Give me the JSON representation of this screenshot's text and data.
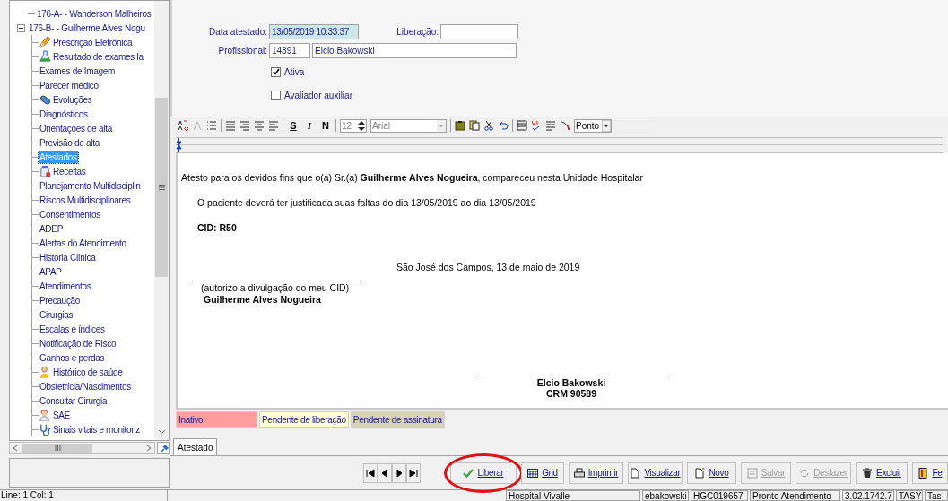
{
  "tree": [
    {
      "label": "176-A-  - Wanderson Malheiros",
      "selected": false
    },
    {
      "label": "176-B-  - Guilherme Alves Nogu",
      "selected": false,
      "expanded": true,
      "children": [
        {
          "label": "Prescrição Eletrônica",
          "kind": "pencil",
          "selected": false
        },
        {
          "label": "Resultado de exames la",
          "kind": "flask",
          "selected": false
        },
        {
          "label": "Exames de Imagem",
          "selected": false
        },
        {
          "label": "Parecer médico",
          "selected": false
        },
        {
          "label": "Evoluções",
          "kind": "capsule",
          "selected": false
        },
        {
          "label": "Diagnósticos",
          "selected": false
        },
        {
          "label": "Orientações de alta",
          "selected": false
        },
        {
          "label": "Previsão de alta",
          "selected": false
        },
        {
          "label": "Atestados",
          "selected": true
        },
        {
          "label": "Receitas",
          "kind": "bottle",
          "selected": false
        },
        {
          "label": "Planejamento Multidisciplin",
          "selected": false
        },
        {
          "label": "Riscos Multidisciplinares",
          "selected": false
        },
        {
          "label": "Consentimentos",
          "selected": false
        },
        {
          "label": "ADEP",
          "selected": false
        },
        {
          "label": "Alertas do Atendimento",
          "selected": false
        },
        {
          "label": "História Clínica",
          "selected": false
        },
        {
          "label": "APAP",
          "selected": false
        },
        {
          "label": "Atendimentos",
          "selected": false
        },
        {
          "label": "Precaução",
          "selected": false
        },
        {
          "label": "Cirurgias",
          "selected": false
        },
        {
          "label": "Escalas e índices",
          "selected": false
        },
        {
          "label": "Notificação de Risco",
          "selected": false
        },
        {
          "label": "Ganhos e perdas",
          "selected": false
        },
        {
          "label": "Histórico de saúde",
          "kind": "person",
          "selected": false
        },
        {
          "label": "Obstetrícia/Nascimentos",
          "selected": false
        },
        {
          "label": "Consultar Cirurgia",
          "selected": false
        },
        {
          "label": "SAE",
          "kind": "nurse",
          "selected": false
        },
        {
          "label": "Sinais vitais e monitoriz",
          "kind": "stethoscope",
          "selected": false
        }
      ]
    }
  ],
  "form": {
    "data_atestado": {
      "label": "Data atestado:",
      "value": "13/05/2019 10:33:37"
    },
    "liberacao": {
      "label": "Liberação:"
    },
    "profissional": {
      "label": "Profissional:",
      "code": "14391",
      "name": "Elcio Bakowski"
    },
    "checkboxes": [
      {
        "label": "Ativa",
        "checked": true
      },
      {
        "label": "Avaliador auxiliar",
        "checked": false
      }
    ]
  },
  "editor_toolbar": {
    "style_buttons": [
      "S",
      "I",
      "N"
    ],
    "font_size": "12",
    "font": "Arial",
    "unit": "Ponto"
  },
  "document": [
    {
      "kind": "lead",
      "text": "Atesto para os devidos fins que o(a) Sr.(a) **Guilherme Alves Nogueira**, compareceu nesta Unidade Hospitalar"
    },
    {
      "kind": "indent",
      "text": "O paciente deverá ter justificada suas faltas do dia 13/05/2019  ao dia 13/05/2019"
    },
    {
      "kind": "cid",
      "text": "CID: R50"
    },
    {
      "kind": "place_date",
      "text": "São José dos Campos, 13 de maio de 2019"
    },
    {
      "kind": "patient_signature",
      "note": "(autorizo a divulgação do meu CID)",
      "name": "Guilherme Alves Nogueira"
    },
    {
      "kind": "doctor_signature",
      "name": "Elcio Bakowski",
      "crm": "CRM 90589"
    }
  ],
  "legend": [
    {
      "label": "Inativo",
      "color": "#ff9c9c"
    },
    {
      "label": "Pendente de liberação",
      "color": "#ffffcc"
    },
    {
      "label": "Pendente de assinatura",
      "color": "#d6d3b0"
    }
  ],
  "tabs": [
    {
      "label": "Atestado",
      "selected": true
    }
  ],
  "actions": [
    {
      "label": "Liberar",
      "kind": "check",
      "disabled": false,
      "circled": true
    },
    {
      "label": "Grid",
      "kind": "grid",
      "disabled": false,
      "circled": false
    },
    {
      "label": "Imprimir",
      "kind": "printer",
      "disabled": false,
      "circled": false
    },
    {
      "label": "Visualizar",
      "kind": "page",
      "disabled": false,
      "circled": false
    },
    {
      "label": "Novo",
      "kind": "new",
      "disabled": false,
      "circled": false
    },
    {
      "label": "Salvar",
      "kind": "save",
      "disabled": true,
      "circled": false
    },
    {
      "label": "Desfazer",
      "kind": "undo",
      "disabled": true,
      "circled": false
    },
    {
      "label": "Excluir",
      "kind": "trash",
      "disabled": false,
      "circled": false
    },
    {
      "label": "Fe",
      "kind": "door",
      "disabled": false,
      "circled": false
    }
  ],
  "status_bar": {
    "position": "Line:  1  Col:  1",
    "cells": [
      "Hospital Vivalle",
      "ebakowski",
      "HGC019657",
      "Pronto Atendimento",
      "3.02.1742.7",
      "TASY",
      "Tas"
    ]
  }
}
